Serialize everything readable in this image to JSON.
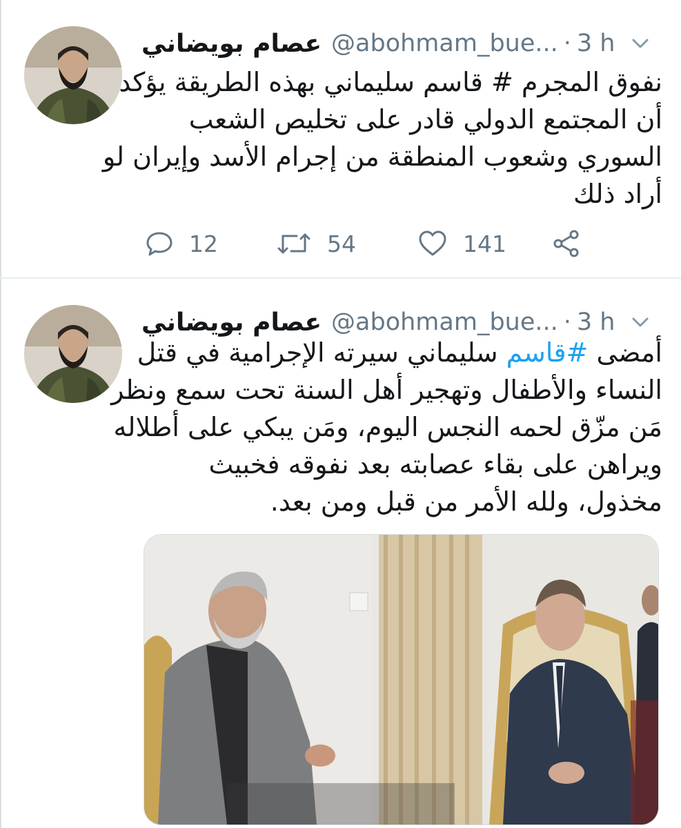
{
  "tweets": [
    {
      "author": {
        "display_name": "عصام بويضاني",
        "handle": "@abohmam_bue...",
        "time": "3 h"
      },
      "text_lines": [
        "نفوق المجرم # قاسم سليماني بهذه الطريقة يؤكد",
        "أن المجتمع الدولي قادر على تخليص الشعب",
        "السوري وشعوب المنطقة من إجرام الأسد وإيران لو",
        "أراد ذلك"
      ],
      "actions": {
        "replies": "12",
        "retweets": "54",
        "likes": "141"
      }
    },
    {
      "author": {
        "display_name": "عصام بويضاني",
        "handle": "@abohmam_bue...",
        "time": "3 h"
      },
      "text_lines": {
        "first_prefix": "أمضى ",
        "hashtag": "#قاسم",
        "first_suffix": " سليماني سيرته الإجرامية في قتل",
        "l2": "النساء والأطفال وتهجير أهل السنة تحت سمع ونظر",
        "l3": "مَن مزّق لحمه النجس اليوم، ومَن يبكي على أطلاله",
        "l4": "ويراهن على بقاء عصابته بعد نفوقه فخبيث",
        "l5": "مخذول، ولله الأمر من قبل ومن بعد."
      }
    }
  ],
  "colors": {
    "accent": "#1da1f2",
    "secondary_text": "#657786",
    "primary_text": "#14171a",
    "divider": "#e6ecf0"
  },
  "icons": [
    "reply-icon",
    "retweet-icon",
    "like-icon",
    "share-icon",
    "chevron-down-icon"
  ]
}
